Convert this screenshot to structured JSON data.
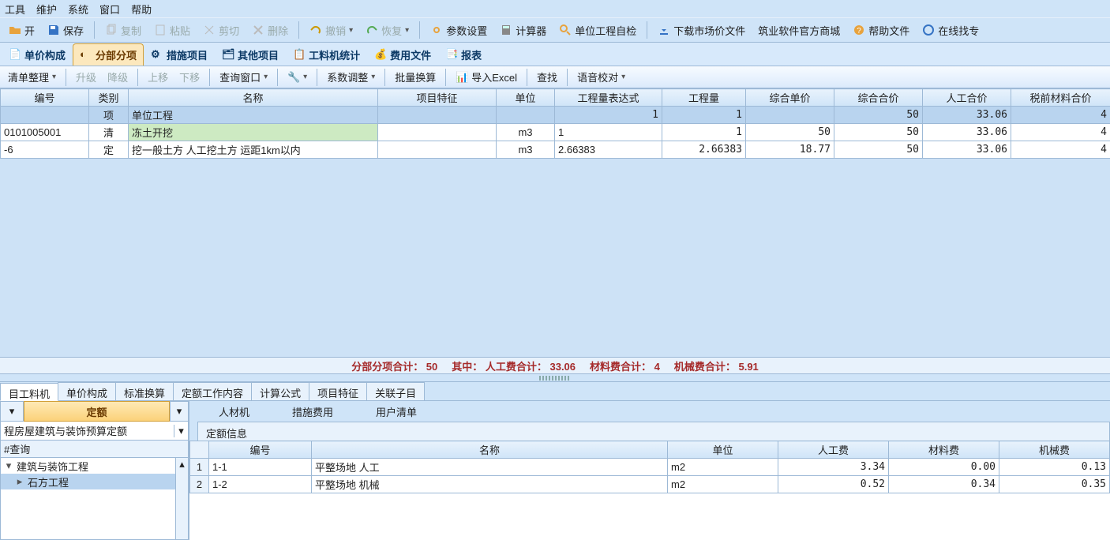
{
  "menu": {
    "tools": "工具",
    "maintain": "维护",
    "system": "系统",
    "window": "窗口",
    "help": "帮助"
  },
  "toolbar": {
    "open": "开",
    "save": "保存",
    "copy": "复制",
    "paste": "粘贴",
    "cut": "剪切",
    "delete": "删除",
    "undo": "撤销",
    "redo": "恢复",
    "params": "参数设置",
    "calculator": "计算器",
    "selfcheck": "单位工程自检",
    "market": "下载市场价文件",
    "mall": "筑业软件官方商城",
    "helpfile": "帮助文件",
    "online": "在线找专"
  },
  "modules": {
    "price": "单价构成",
    "fbfx": "分部分项",
    "measure": "措施项目",
    "other": "其他项目",
    "stat": "工料机统计",
    "feefile": "费用文件",
    "report": "报表"
  },
  "sec": {
    "arrange": "清单整理",
    "up": "升级",
    "down": "降级",
    "moveup": "上移",
    "movedown": "下移",
    "querywin": "查询窗口",
    "coef": "系数调整",
    "batch": "批量换算",
    "excel": "导入Excel",
    "find": "查找",
    "voice": "语音校对"
  },
  "grid": {
    "headers": [
      "编号",
      "类别",
      "名称",
      "项目特征",
      "单位",
      "工程量表达式",
      "工程量",
      "综合单价",
      "综合合价",
      "人工合价",
      "税前材料合价"
    ],
    "rows": [
      {
        "no": "",
        "cat": "项",
        "name": "单位工程",
        "feat": "",
        "unit": "",
        "expr": "1",
        "qty": "1",
        "uprice": "",
        "total": "50",
        "labor": "33.06",
        "mat": "4"
      },
      {
        "no": "0101005001",
        "cat": "清",
        "name": "冻土开挖",
        "feat": "",
        "unit": "m3",
        "expr": "1",
        "qty": "1",
        "uprice": "50",
        "total": "50",
        "labor": "33.06",
        "mat": "4"
      },
      {
        "no": "-6",
        "cat": "定",
        "name": "挖一般土方 人工挖土方 运距1km以内",
        "feat": "",
        "unit": "m3",
        "expr": "2.66383",
        "qty": "2.66383",
        "uprice": "18.77",
        "total": "50",
        "labor": "33.06",
        "mat": "4"
      }
    ]
  },
  "summary": {
    "s1": "分部分项合计： 50",
    "s2": "其中： 人工费合计： 33.06",
    "s3": "材料费合计： 4",
    "s4": "机械费合计： 5.91"
  },
  "chart_data": {
    "type": "table",
    "title": "分部分项",
    "columns": [
      "编号",
      "类别",
      "名称",
      "项目特征",
      "单位",
      "工程量表达式",
      "工程量",
      "综合单价",
      "综合合价",
      "人工合价",
      "税前材料合价"
    ],
    "rows": [
      [
        "",
        "项",
        "单位工程",
        "",
        "",
        "1",
        "1",
        "",
        "50",
        "33.06",
        "4"
      ],
      [
        "0101005001",
        "清",
        "冻土开挖",
        "",
        "m3",
        "1",
        "1",
        "50",
        "50",
        "33.06",
        "4"
      ],
      [
        "-6",
        "定",
        "挖一般土方 人工挖土方 运距1km以内",
        "",
        "m3",
        "2.66383",
        "2.66383",
        "18.77",
        "50",
        "33.06",
        "4"
      ]
    ],
    "summary": {
      "分部分项合计": 50,
      "人工费合计": 33.06,
      "材料费合计": 4,
      "机械费合计": 5.91
    }
  },
  "btabs": {
    "t1": "目工料机",
    "t2": "单价构成",
    "t3": "标准换算",
    "t4": "定额工作内容",
    "t5": "计算公式",
    "t6": "项目特征",
    "t7": "关联子目"
  },
  "cats": {
    "quota": "定额",
    "rcl": "人材机",
    "measure": "措施费用",
    "user": "用户清单"
  },
  "left": {
    "catalog": "程房屋建筑与装饰预算定额",
    "search": "#查询",
    "n1": "建筑与装饰工程",
    "n2": "石方工程"
  },
  "info": {
    "title": "定额信息",
    "headers": [
      "编号",
      "名称",
      "单位",
      "人工费",
      "材料费",
      "机械费"
    ],
    "rows": [
      {
        "idx": "1",
        "no": "1-1",
        "name": "平整场地 人工",
        "unit": "m2",
        "labor": "3.34",
        "mat": "0.00",
        "mech": "0.13"
      },
      {
        "idx": "2",
        "no": "1-2",
        "name": "平整场地 机械",
        "unit": "m2",
        "labor": "0.52",
        "mat": "0.34",
        "mech": "0.35"
      }
    ]
  }
}
